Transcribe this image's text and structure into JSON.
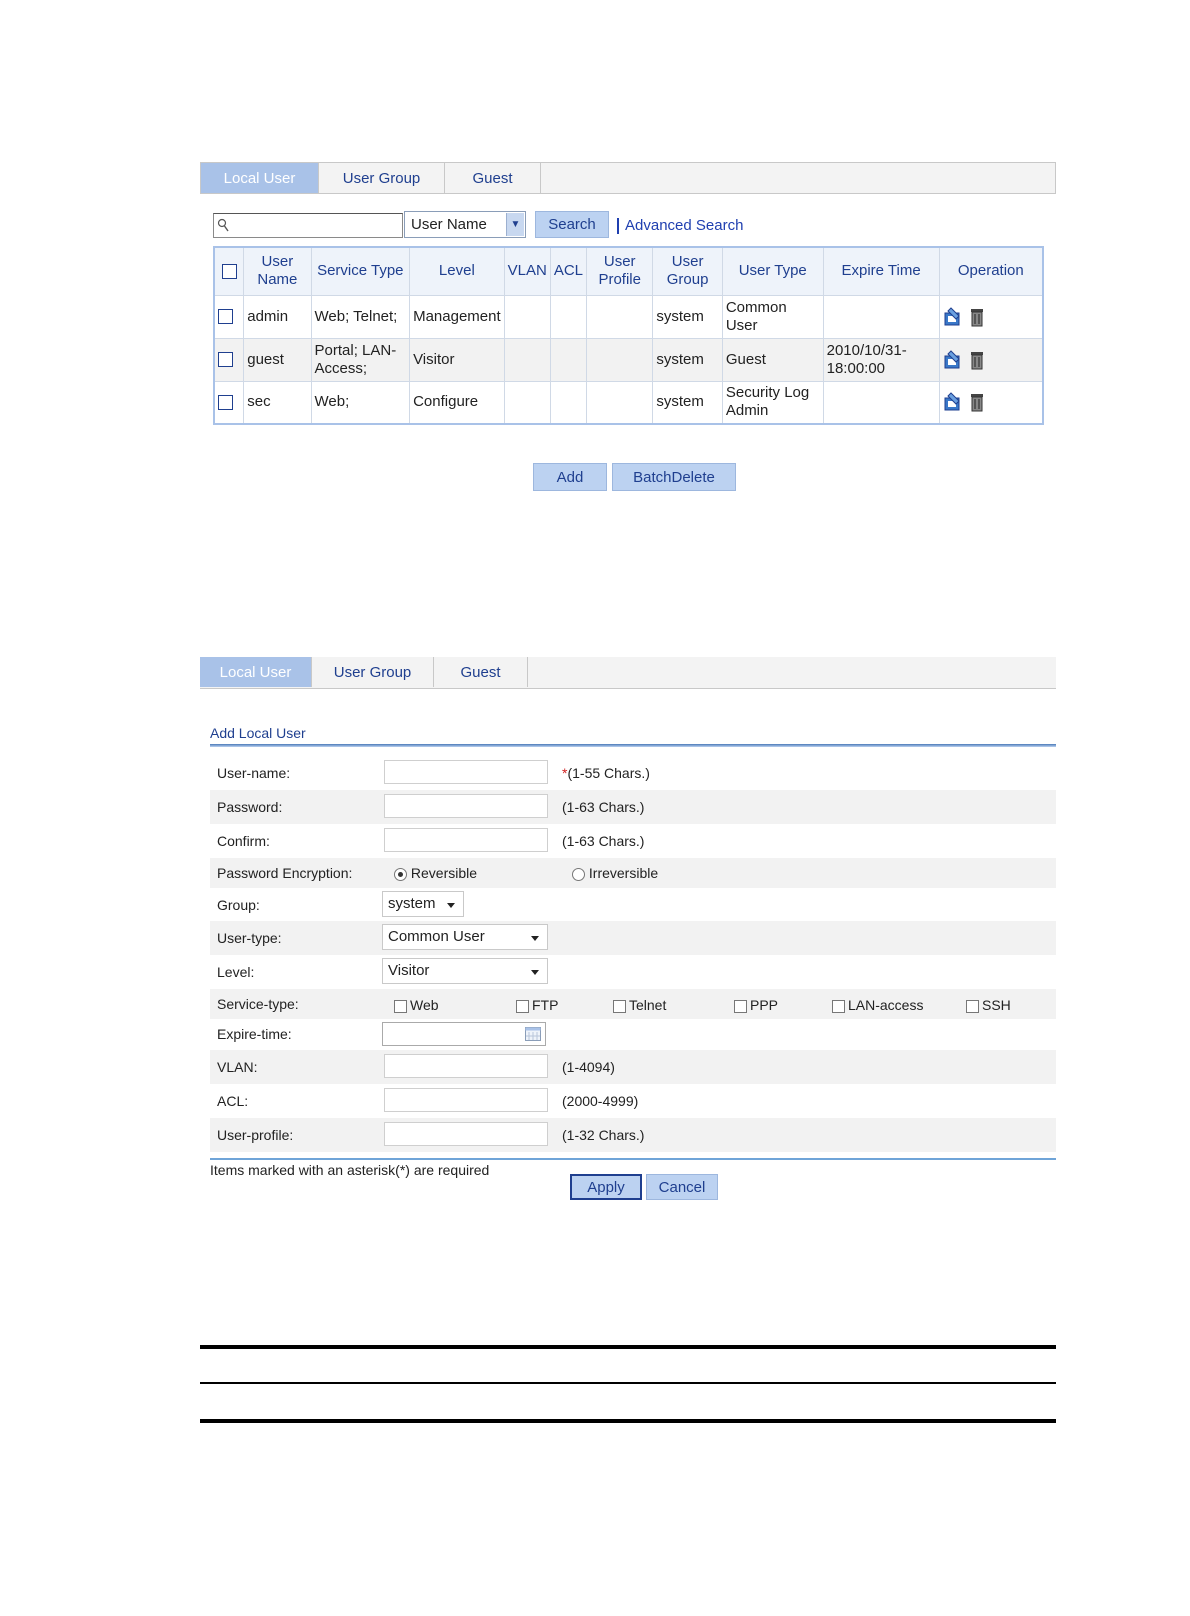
{
  "tabs": [
    {
      "label": "Local User",
      "active": true
    },
    {
      "label": "User Group",
      "active": false
    },
    {
      "label": "Guest",
      "active": false
    }
  ],
  "search": {
    "value": "",
    "field_selected": "User Name",
    "search_label": "Search",
    "advanced_label": "Advanced Search"
  },
  "table": {
    "headers": [
      "User Name",
      "Service Type",
      "Level",
      "VLAN",
      "ACL",
      "User Profile",
      "User Group",
      "User Type",
      "Expire Time",
      "Operation"
    ],
    "rows": [
      {
        "user_name": "admin",
        "service_type": "Web; Telnet;",
        "level": "Management",
        "vlan": "",
        "acl": "",
        "user_profile": "",
        "user_group": "system",
        "user_type": "Common User",
        "expire_time": ""
      },
      {
        "user_name": "guest",
        "service_type": "Portal; LAN-Access;",
        "level": "Visitor",
        "vlan": "",
        "acl": "",
        "user_profile": "",
        "user_group": "system",
        "user_type": "Guest",
        "expire_time": "2010/10/31-18:00:00"
      },
      {
        "user_name": "sec",
        "service_type": "Web;",
        "level": "Configure",
        "vlan": "",
        "acl": "",
        "user_profile": "",
        "user_group": "system",
        "user_type": "Security Log Admin",
        "expire_time": ""
      }
    ],
    "icons": [
      "modify-icon",
      "delete-icon"
    ]
  },
  "list_buttons": {
    "add": "Add",
    "batch_delete": "BatchDelete"
  },
  "form": {
    "title": "Add Local User",
    "username_label": "User-name:",
    "username_value": "",
    "username_hint_star": "*",
    "username_hint": "(1-55 Chars.)",
    "password_label": "Password:",
    "password_value": "",
    "password_hint": "(1-63 Chars.)",
    "confirm_label": "Confirm:",
    "confirm_value": "",
    "confirm_hint": "(1-63 Chars.)",
    "encryption_label": "Password Encryption:",
    "encryption_options": [
      "Reversible",
      "Irreversible"
    ],
    "encryption_selected": "Reversible",
    "group_label": "Group:",
    "group_value": "system",
    "usertype_label": "User-type:",
    "usertype_value": "Common User",
    "level_label": "Level:",
    "level_value": "Visitor",
    "servicetype_label": "Service-type:",
    "service_options": [
      "Web",
      "FTP",
      "Telnet",
      "PPP",
      "LAN-access",
      "SSH"
    ],
    "expire_label": "Expire-time:",
    "expire_value": "",
    "vlan_label": "VLAN:",
    "vlan_value": "",
    "vlan_hint": "(1-4094)",
    "acl_label": "ACL:",
    "acl_value": "",
    "acl_hint": "(2000-4999)",
    "profile_label": "User-profile:",
    "profile_value": "",
    "profile_hint": "(1-32 Chars.)",
    "required_note": "Items marked with an asterisk(*) are required",
    "apply_label": "Apply",
    "cancel_label": "Cancel"
  },
  "colors": {
    "accent": "#1f3f8f",
    "tab_active": "#a9c2e8",
    "button": "#bcd2f1"
  }
}
